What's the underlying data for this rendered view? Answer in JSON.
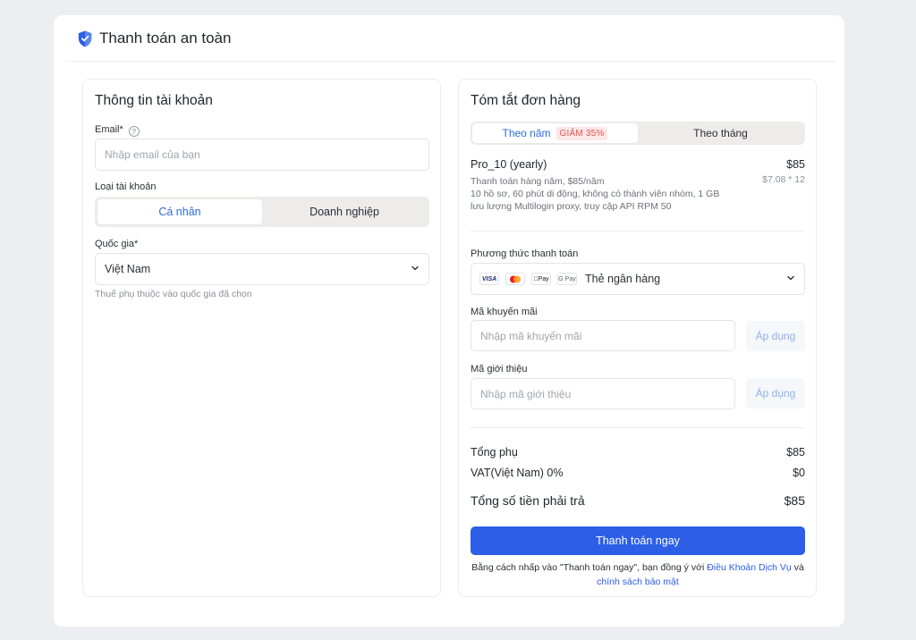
{
  "header": {
    "title": "Thanh toán an toàn",
    "icon": "shield-icon"
  },
  "account": {
    "title": "Thông tin tài khoản",
    "email_label": "Email*",
    "email_placeholder": "Nhập email của bạn",
    "type_label": "Loại tài khoản",
    "type_options": [
      "Cá nhân",
      "Doanh nghiệp"
    ],
    "type_selected": "Cá nhân",
    "country_label": "Quốc gia*",
    "country_value": "Việt Nam",
    "country_note": "Thuế phụ thuộc vào quốc gia đã chọn"
  },
  "order": {
    "title": "Tóm tắt đơn hàng",
    "billing": {
      "yearly": "Theo năm",
      "discount_badge": "GIẢM 35%",
      "monthly": "Theo tháng",
      "selected": "Theo năm"
    },
    "plan": {
      "name": "Pro_10 (yearly)",
      "price": "$85",
      "sub_price": "$7.08 * 12",
      "desc_lines": [
        "Thanh toán hàng năm, $85/năm",
        "10 hồ sơ, 60 phút di động, không có thành viên nhóm, 1 GB",
        "lưu lượng Multilogin proxy, truy cập API RPM 50"
      ]
    },
    "payment_label": "Phương thức thanh toán",
    "payment_icons": [
      "VISA",
      "mastercard-icon",
      "Pay",
      "G Pay"
    ],
    "payment_value": "Thẻ ngân hàng",
    "promo_label": "Mã khuyến mãi",
    "promo_placeholder": "Nhập mã khuyến mãi",
    "referral_label": "Mã giới thiệu",
    "referral_placeholder": "Nhập mã giới thiệu",
    "apply_label": "Áp dụng",
    "subtotal_label": "Tổng phụ",
    "subtotal_value": "$85",
    "vat_label": "VAT(Việt Nam) 0%",
    "vat_value": "$0",
    "total_label": "Tổng số tiền phải trả",
    "total_value": "$85",
    "pay_button": "Thanh toán ngay",
    "terms_prefix": "Bằng cách nhấp vào \"Thanh toán ngay\", bạn đồng ý với ",
    "terms_link": "Điều Khoản Dịch Vụ",
    "terms_and": " và",
    "privacy_link": "chính sách bảo mật"
  },
  "colors": {
    "accent": "#2c5ee8",
    "badge_bg": "#fde7e7",
    "badge_text": "#e05656",
    "background": "#eceef1"
  }
}
